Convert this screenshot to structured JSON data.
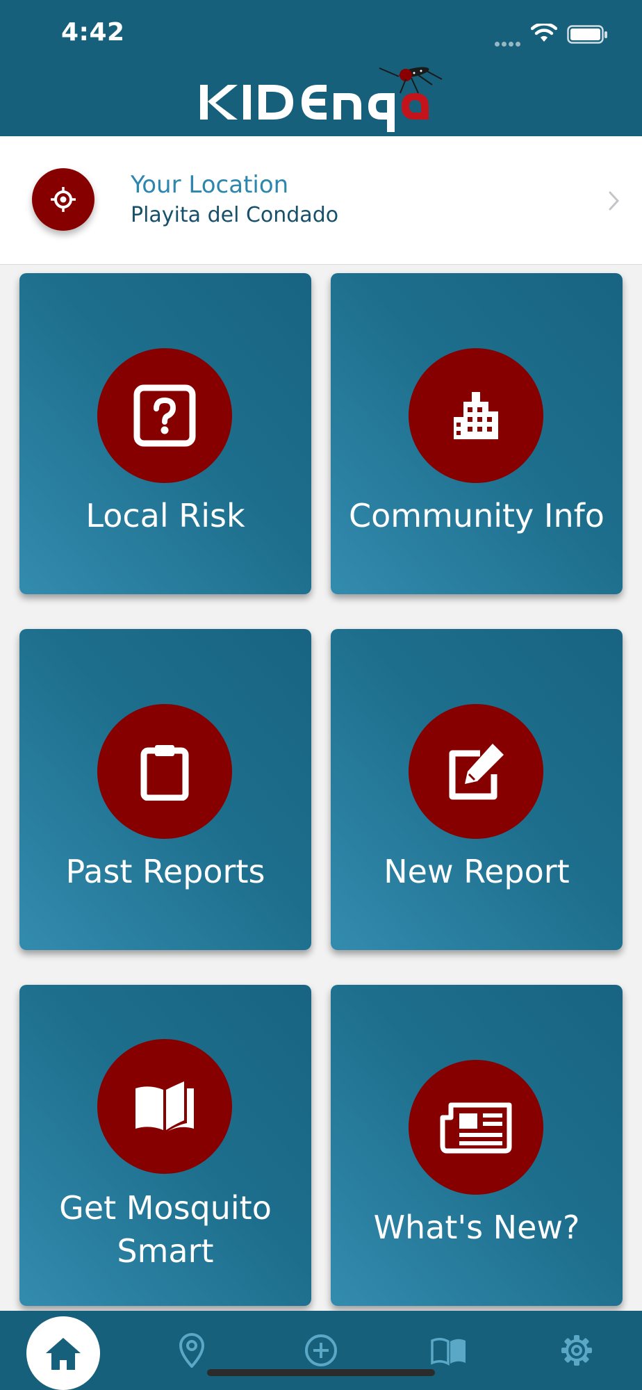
{
  "status_bar": {
    "time": "4:42"
  },
  "header": {
    "logo_text": "KIDENGA"
  },
  "location": {
    "title": "Your Location",
    "name": "Playita del Condado"
  },
  "tiles": [
    {
      "label": "Local Risk",
      "icon": "question-square-icon"
    },
    {
      "label": "Community Info",
      "icon": "building-icon"
    },
    {
      "label": "Past Reports",
      "icon": "clipboard-icon"
    },
    {
      "label": "New Report",
      "icon": "edit-icon"
    },
    {
      "label": "Get Mosquito Smart",
      "icon": "book-icon"
    },
    {
      "label": "What's New?",
      "icon": "newspaper-icon"
    }
  ],
  "tab_bar": {
    "items": [
      "home-icon",
      "map-pin-icon",
      "plus-circle-icon",
      "book-icon",
      "gear-icon"
    ]
  },
  "colors": {
    "header": "#17607b",
    "accent": "#860000",
    "tile": "#1d6e8c"
  }
}
